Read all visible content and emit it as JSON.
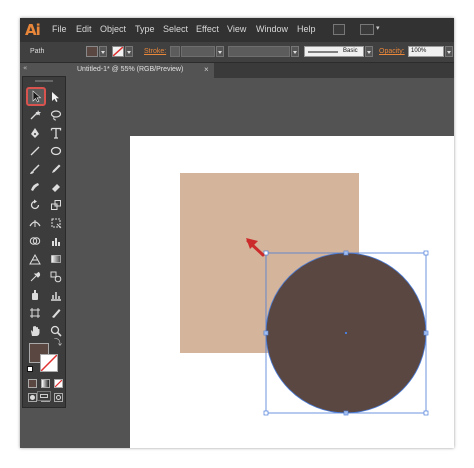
{
  "app": {
    "logo": "Ai"
  },
  "menu": [
    "File",
    "Edit",
    "Object",
    "Type",
    "Select",
    "Effect",
    "View",
    "Window",
    "Help"
  ],
  "control_bar": {
    "selection_label": "Path",
    "stroke_label": "Stroke:",
    "brush_label": "Basic",
    "opacity_label": "Opacity:",
    "opacity_value": "100%"
  },
  "document": {
    "tab_title": "Untitled-1* @ 55% (RGB/Preview)",
    "close_glyph": "×"
  },
  "toolbar": {
    "collapse_glyph": "«",
    "active_tool": "selection-tool"
  },
  "colors": {
    "fill": "#5a4742",
    "square": "#d4b49a",
    "circle": "#5a4742",
    "selection": "#4a7cd9",
    "highlight": "#d9534f",
    "pointer": "#cc2b2b"
  },
  "canvas": {
    "shapes": [
      "square",
      "circle"
    ],
    "selected": "circle"
  }
}
